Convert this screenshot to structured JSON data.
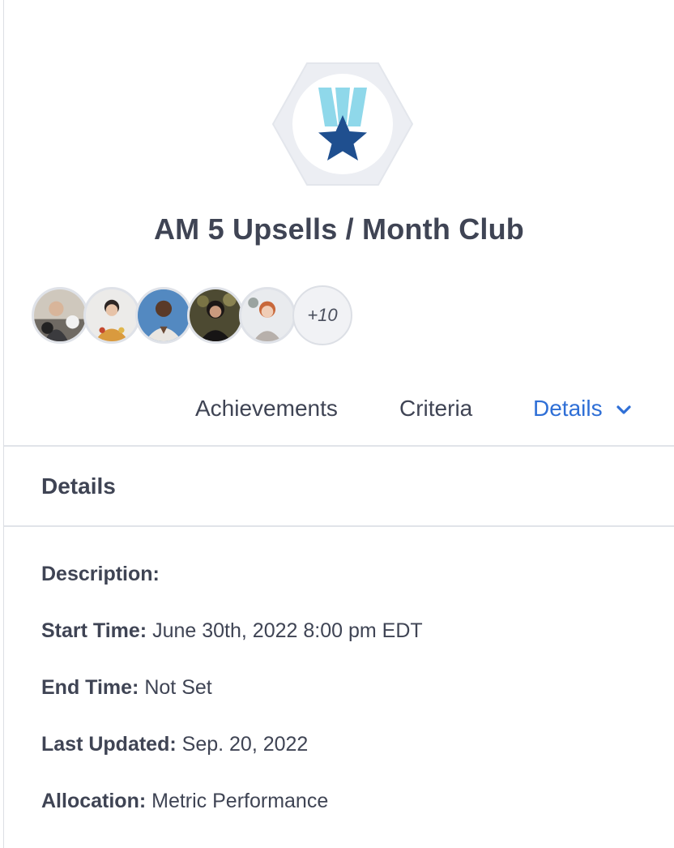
{
  "badge": {
    "icon": "medal-star-icon",
    "colors": {
      "hexagon": "#eceef3",
      "ribbon": "#8fd8ea",
      "star": "#1f4f8f"
    }
  },
  "title": "AM 5 Upsells / Month Club",
  "members": {
    "avatars": [
      {
        "name": "member-1"
      },
      {
        "name": "member-2"
      },
      {
        "name": "member-3"
      },
      {
        "name": "member-4"
      },
      {
        "name": "member-5"
      }
    ],
    "more_label": "+10"
  },
  "tabs": [
    {
      "label": "Achievements",
      "active": false
    },
    {
      "label": "Criteria",
      "active": false
    },
    {
      "label": "Details",
      "active": true,
      "icon": "chevron-down-icon"
    }
  ],
  "details": {
    "heading": "Details",
    "rows": [
      {
        "label": "Description:",
        "value": ""
      },
      {
        "label": "Start Time:",
        "value": "June 30th, 2022 8:00 pm EDT"
      },
      {
        "label": "End Time:",
        "value": "Not Set"
      },
      {
        "label": "Last Updated:",
        "value": "Sep. 20, 2022"
      },
      {
        "label": "Allocation:",
        "value": "Metric Performance"
      }
    ]
  },
  "colors": {
    "accent": "#2f6fd6",
    "text": "#3f4454",
    "divider": "#e1e4e9"
  }
}
